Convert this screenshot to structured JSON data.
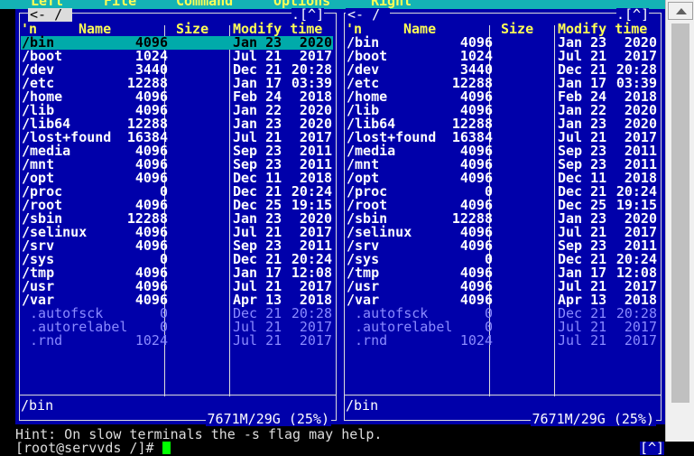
{
  "menu": [
    "Left",
    "File",
    "Command",
    "Options",
    "Right"
  ],
  "left_panel": {
    "path": "/",
    "corner_button": "[^]",
    "columns": {
      "name_prefix": "'n",
      "name": "Name",
      "size": "Size",
      "modify": "Modify time"
    },
    "status_path": "/bin",
    "free_space": "7671M/29G (25%)",
    "selected_index": 0
  },
  "right_panel": {
    "path": "/",
    "corner_button": "[^]",
    "columns": {
      "name_prefix": "'n",
      "name": "Name",
      "size": "Size",
      "modify": "Modify time"
    },
    "status_path": "/bin",
    "free_space": "7671M/29G (25%)",
    "selected_index": -1
  },
  "files": [
    {
      "name": "/bin",
      "size": "4096",
      "date": "Jan 23",
      "time": "2020",
      "hidden": false
    },
    {
      "name": "/boot",
      "size": "1024",
      "date": "Jul 21",
      "time": "2017",
      "hidden": false
    },
    {
      "name": "/dev",
      "size": "3440",
      "date": "Dec 21",
      "time": "20:28",
      "hidden": false
    },
    {
      "name": "/etc",
      "size": "12288",
      "date": "Jan 17",
      "time": "03:39",
      "hidden": false
    },
    {
      "name": "/home",
      "size": "4096",
      "date": "Feb 24",
      "time": "2018",
      "hidden": false
    },
    {
      "name": "/lib",
      "size": "4096",
      "date": "Jan 22",
      "time": "2020",
      "hidden": false
    },
    {
      "name": "/lib64",
      "size": "12288",
      "date": "Jan 23",
      "time": "2020",
      "hidden": false
    },
    {
      "name": "/lost+found",
      "size": "16384",
      "date": "Jul 21",
      "time": "2017",
      "hidden": false
    },
    {
      "name": "/media",
      "size": "4096",
      "date": "Sep 23",
      "time": "2011",
      "hidden": false
    },
    {
      "name": "/mnt",
      "size": "4096",
      "date": "Sep 23",
      "time": "2011",
      "hidden": false
    },
    {
      "name": "/opt",
      "size": "4096",
      "date": "Dec 11",
      "time": "2018",
      "hidden": false
    },
    {
      "name": "/proc",
      "size": "0",
      "date": "Dec 21",
      "time": "20:24",
      "hidden": false
    },
    {
      "name": "/root",
      "size": "4096",
      "date": "Dec 25",
      "time": "19:15",
      "hidden": false
    },
    {
      "name": "/sbin",
      "size": "12288",
      "date": "Jan 23",
      "time": "2020",
      "hidden": false
    },
    {
      "name": "/selinux",
      "size": "4096",
      "date": "Jul 21",
      "time": "2017",
      "hidden": false
    },
    {
      "name": "/srv",
      "size": "4096",
      "date": "Sep 23",
      "time": "2011",
      "hidden": false
    },
    {
      "name": "/sys",
      "size": "0",
      "date": "Dec 21",
      "time": "20:24",
      "hidden": false
    },
    {
      "name": "/tmp",
      "size": "4096",
      "date": "Jan 17",
      "time": "12:08",
      "hidden": false
    },
    {
      "name": "/usr",
      "size": "4096",
      "date": "Jul 21",
      "time": "2017",
      "hidden": false
    },
    {
      "name": "/var",
      "size": "4096",
      "date": "Apr 13",
      "time": "2018",
      "hidden": false
    },
    {
      "name": " .autofsck",
      "size": "0",
      "date": "Dec 21",
      "time": "20:28",
      "hidden": true
    },
    {
      "name": " .autorelabel",
      "size": "0",
      "date": "Jul 21",
      "time": "2017",
      "hidden": true
    },
    {
      "name": " .rnd",
      "size": "1024",
      "date": "Jul 21",
      "time": "2017",
      "hidden": true
    }
  ],
  "hint": "Hint: On slow terminals the -s flag may help.",
  "prompt": "[root@servvds /]# ",
  "bottom_corner_button": "[^]",
  "colors": {
    "panel_bg": "#0000aa",
    "selection": "#00aaaa",
    "header": "#ffff55",
    "menu_bar": "#14b3b5",
    "cursor": "#00ff00"
  }
}
